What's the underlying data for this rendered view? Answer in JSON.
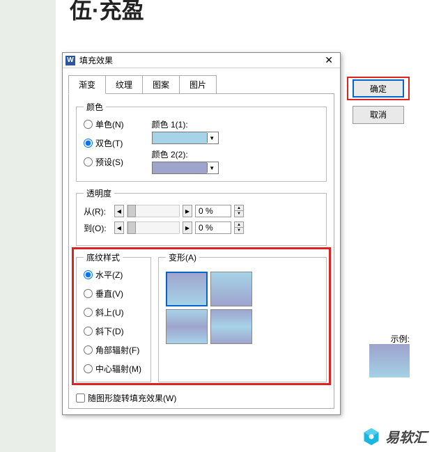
{
  "page": {
    "title_fragment": "伍·充盈"
  },
  "dialog": {
    "title": "填充效果",
    "tabs": [
      "渐变",
      "纹理",
      "图案",
      "图片"
    ],
    "active_tab": 0,
    "buttons": {
      "ok": "确定",
      "cancel": "取消"
    },
    "color_section": {
      "legend": "颜色",
      "radios": [
        {
          "label": "单色(N)",
          "checked": false
        },
        {
          "label": "双色(T)",
          "checked": true
        },
        {
          "label": "预设(S)",
          "checked": false
        }
      ],
      "color1_label": "颜色 1(1):",
      "color2_label": "颜色 2(2):",
      "color1": "#a6d3e8",
      "color2": "#9fa4cd"
    },
    "transparency_section": {
      "legend": "透明度",
      "from_label": "从(R):",
      "to_label": "到(O):",
      "from_value": "0 %",
      "to_value": "0 %"
    },
    "style_section": {
      "legend": "底纹样式",
      "radios": [
        {
          "label": "水平(Z)",
          "checked": true
        },
        {
          "label": "垂直(V)",
          "checked": false
        },
        {
          "label": "斜上(U)",
          "checked": false
        },
        {
          "label": "斜下(D)",
          "checked": false
        },
        {
          "label": "角部辐射(F)",
          "checked": false
        },
        {
          "label": "中心辐射(M)",
          "checked": false
        }
      ]
    },
    "variant_section": {
      "legend": "变形(A)",
      "selected": 0
    },
    "sample_label": "示例:",
    "rotate_label": "随图形旋转填充效果(W)",
    "rotate_checked": false
  },
  "watermark": {
    "text": "易软汇"
  }
}
